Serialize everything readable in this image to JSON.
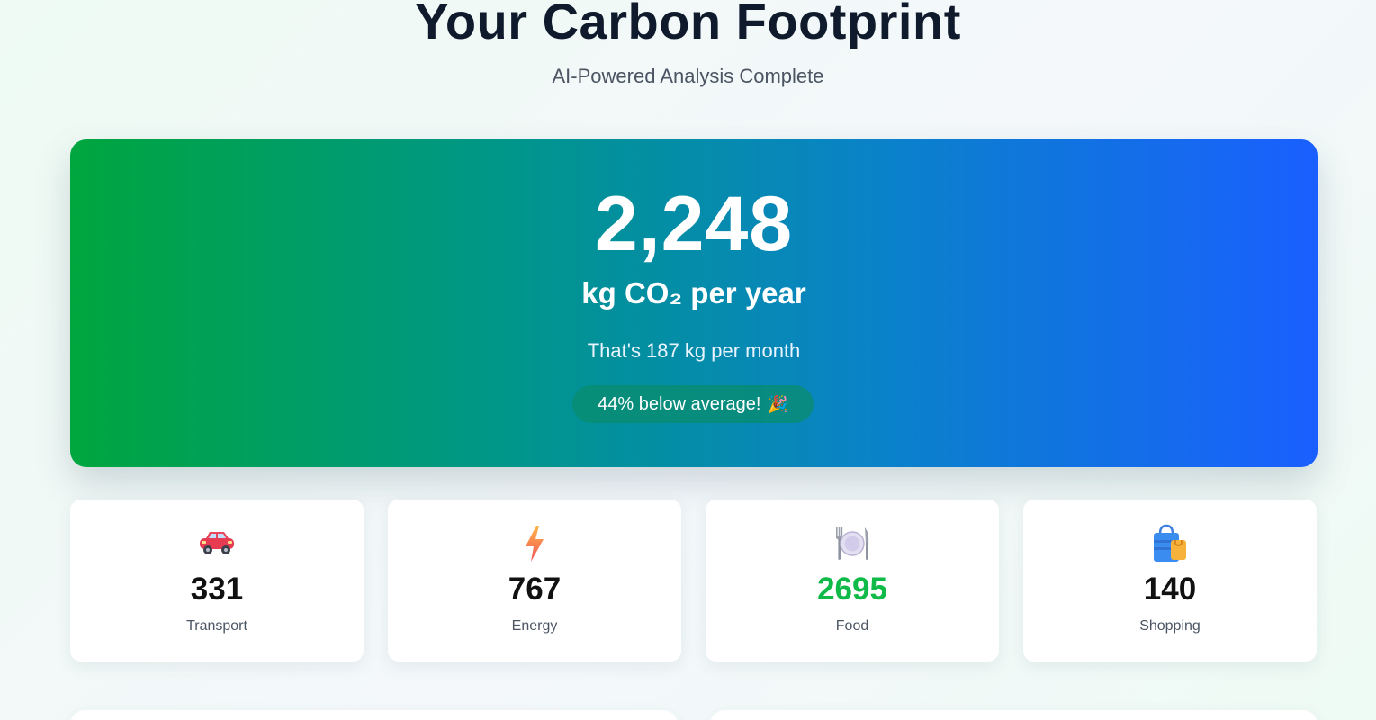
{
  "header": {
    "title": "Your Carbon Footprint",
    "subtitle": "AI-Powered Analysis Complete"
  },
  "summary": {
    "total": "2,248",
    "unit": "kg CO₂ per year",
    "monthly_text": "That's 187 kg per month",
    "badge_text": "44% below average!",
    "badge_icon": "party-popper-icon"
  },
  "categories": [
    {
      "label": "Transport",
      "value": "331",
      "icon": "car-icon"
    },
    {
      "label": "Energy",
      "value": "767",
      "icon": "lightning-icon"
    },
    {
      "label": "Food",
      "value": "2695",
      "icon": "plate-cutlery-icon",
      "value_color": "#0fba48"
    },
    {
      "label": "Shopping",
      "value": "140",
      "icon": "shopping-bag-icon"
    }
  ],
  "colors": {
    "gradient_start": "#00a63e",
    "gradient_end": "#1a5fff",
    "highlight_green": "#0fba48"
  }
}
